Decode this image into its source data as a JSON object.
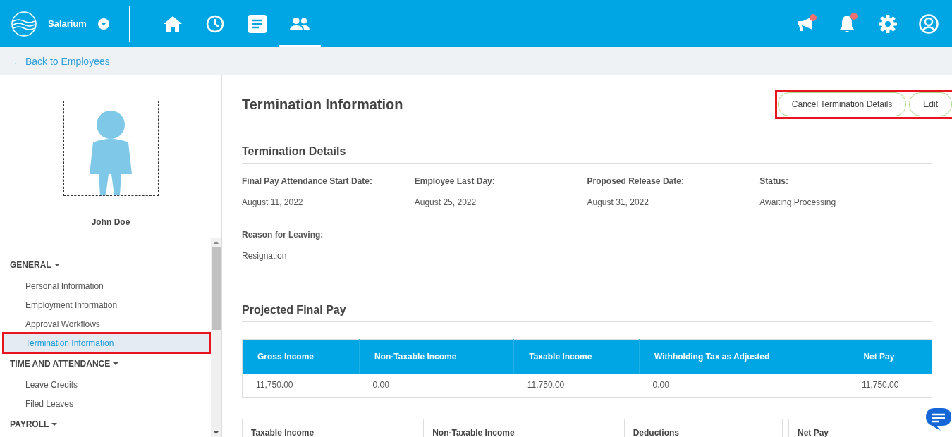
{
  "app": {
    "brand": "Salarium"
  },
  "nav_tabs": [
    {
      "kind": "home",
      "selected": false
    },
    {
      "kind": "clock",
      "selected": false
    },
    {
      "kind": "document",
      "selected": false
    },
    {
      "kind": "people",
      "selected": true
    }
  ],
  "header_icons": [
    {
      "kind": "megaphone",
      "badge": true
    },
    {
      "kind": "bell",
      "badge": true
    },
    {
      "kind": "gear"
    },
    {
      "kind": "user"
    }
  ],
  "back_link": "← Back to Employees",
  "profile": {
    "name": "John Doe"
  },
  "sidebar": {
    "sections": [
      {
        "title": "GENERAL",
        "expanded": true,
        "items": [
          {
            "label": "Personal Information",
            "selected": false,
            "highlighted": false
          },
          {
            "label": "Employment Information",
            "selected": false,
            "highlighted": false
          },
          {
            "label": "Approval Workflows",
            "selected": false,
            "highlighted": false
          },
          {
            "label": "Termination Information",
            "selected": true,
            "highlighted": true
          }
        ]
      },
      {
        "title": "TIME AND ATTENDANCE",
        "expanded": true,
        "items": [
          {
            "label": "Leave Credits",
            "selected": false,
            "highlighted": false
          },
          {
            "label": "Filed Leaves",
            "selected": false,
            "highlighted": false
          }
        ]
      },
      {
        "title": "PAYROLL",
        "expanded": true
      }
    ]
  },
  "page": {
    "title": "Termination Information",
    "actions": {
      "highlighted": true,
      "buttons": [
        "Cancel Termination Details",
        "Edit"
      ]
    }
  },
  "termination_details": {
    "title": "Termination Details",
    "fields": [
      {
        "label": "Final Pay Attendance Start Date:",
        "value": "August 11, 2022"
      },
      {
        "label": "Employee Last Day:",
        "value": "August 25, 2022"
      },
      {
        "label": "Proposed Release Date:",
        "value": "August 31, 2022"
      },
      {
        "label": "Status:",
        "value": "Awaiting Processing"
      },
      {
        "label": "Reason for Leaving:",
        "value": "Resignation"
      }
    ]
  },
  "projected_final_pay": {
    "title": "Projected Final Pay",
    "table": {
      "columns": [
        "Gross Income",
        "Non-Taxable Income",
        "Taxable Income",
        "Withholding Tax as Adjusted",
        "Net Pay"
      ],
      "rows": [
        [
          "11,750.00",
          "0.00",
          "11,750.00",
          "0.00",
          "11,750.00"
        ]
      ]
    }
  },
  "summary_cards": [
    "Taxable Income",
    "Non-Taxable Income",
    "Deductions",
    "Net Pay"
  ]
}
